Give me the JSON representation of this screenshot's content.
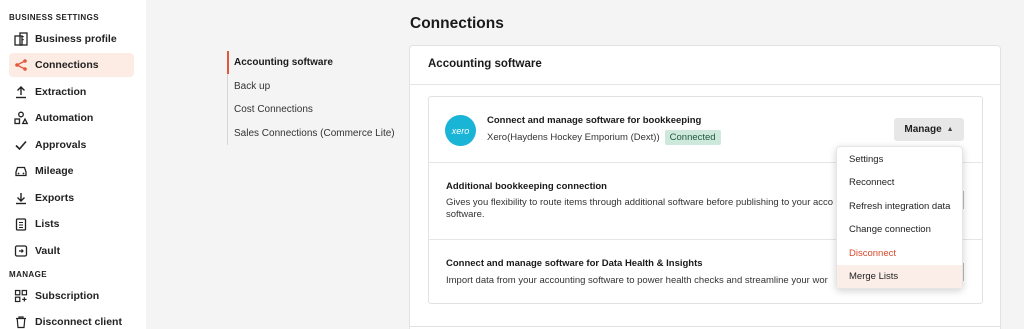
{
  "sidebar": {
    "heading_business": "BUSINESS SETTINGS",
    "heading_manage": "MANAGE",
    "items": [
      {
        "label": "Business profile",
        "icon": "building-icon"
      },
      {
        "label": "Connections",
        "icon": "connections-icon",
        "active": true
      },
      {
        "label": "Extraction",
        "icon": "upload-icon"
      },
      {
        "label": "Automation",
        "icon": "automation-icon"
      },
      {
        "label": "Approvals",
        "icon": "check-icon"
      },
      {
        "label": "Mileage",
        "icon": "car-icon"
      },
      {
        "label": "Exports",
        "icon": "download-icon"
      },
      {
        "label": "Lists",
        "icon": "clipboard-icon"
      },
      {
        "label": "Vault",
        "icon": "vault-icon"
      }
    ],
    "manage_items": [
      {
        "label": "Subscription",
        "icon": "grid-plus-icon"
      },
      {
        "label": "Disconnect client",
        "icon": "trash-icon"
      }
    ]
  },
  "page": {
    "title": "Connections"
  },
  "subnav": {
    "items": [
      "Accounting software",
      "Back up",
      "Cost Connections",
      "Sales Connections (Commerce Lite)"
    ]
  },
  "card": {
    "title": "Accounting software",
    "row1": {
      "logo_text": "xero",
      "title": "Connect and manage software for bookkeeping",
      "org": "Xero(Haydens Hockey Emporium (Dext))",
      "status": "Connected",
      "manage_label": "Manage"
    },
    "row2": {
      "title": "Additional bookkeeping connection",
      "desc": "Gives you flexibility to route items through additional software before publishing to your acco software."
    },
    "row3": {
      "title": "Connect and manage software for Data Health & Insights",
      "desc": "Import data from your accounting software to power health checks and streamline your wor"
    }
  },
  "dropdown": {
    "items": [
      "Settings",
      "Reconnect",
      "Refresh integration data",
      "Change connection",
      "Disconnect",
      "Merge Lists"
    ]
  },
  "colors": {
    "accent": "#e2583a",
    "active_bg": "#fdece3",
    "connected_bg": "#cfe8dc",
    "xero": "#1ab4d7",
    "danger": "#d8482c"
  }
}
